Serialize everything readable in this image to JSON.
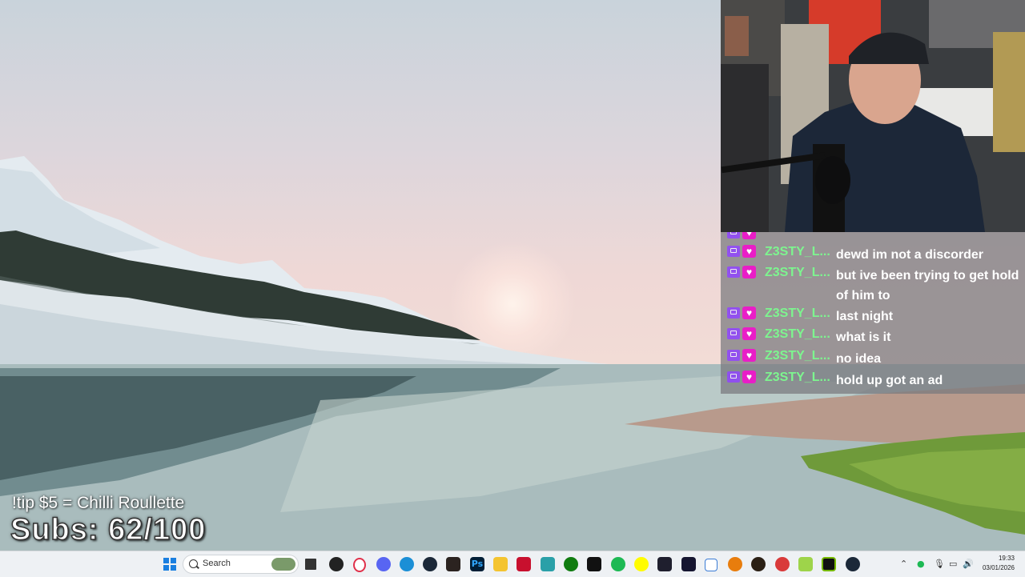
{
  "overlay": {
    "tip_text": "!tip $5 = Chilli Roullette",
    "subs_text": "Subs: 62/100"
  },
  "chat": {
    "messages": [
      {
        "user": "Z3STY_L...",
        "text": "dewd im not a discorder"
      },
      {
        "user": "Z3STY_L...",
        "text": "but ive been trying to get hold of him to"
      },
      {
        "user": "Z3STY_L...",
        "text": "last night"
      },
      {
        "user": "Z3STY_L...",
        "text": "what is it"
      },
      {
        "user": "Z3STY_L...",
        "text": "no idea"
      },
      {
        "user": "Z3STY_L...",
        "text": "hold up got an ad"
      }
    ]
  },
  "taskbar": {
    "search_label": "Search",
    "clock_time": "19:33",
    "clock_date": "03/01/2026",
    "apps": [
      "windows-start",
      "widgets",
      "task-view",
      "media",
      "opera",
      "discord",
      "edge",
      "steam",
      "app-bars",
      "photoshop",
      "file-explorer",
      "video-editor",
      "notepad",
      "xbox",
      "capcut",
      "spotify",
      "snapchat",
      "app-dark",
      "app-dark-2",
      "window-app",
      "blender",
      "game-app",
      "app-red",
      "app-green",
      "nvidia",
      "steam-2"
    ],
    "tray": [
      "chevron-up",
      "wifi",
      "mic",
      "speaker"
    ]
  },
  "colors": {
    "username": "#7df58f",
    "chat_bg": "rgba(120,120,125,0.72)",
    "twitch_purple": "#9146ff",
    "badge_pink": "#e91ec7"
  }
}
